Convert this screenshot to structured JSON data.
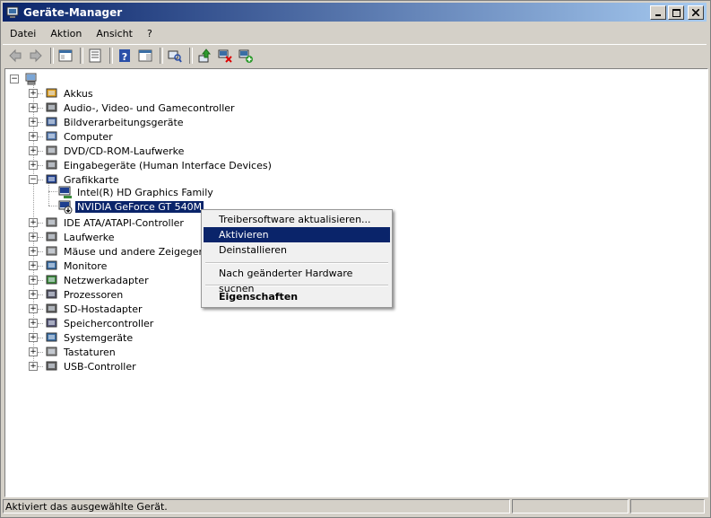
{
  "window": {
    "title": "Geräte-Manager"
  },
  "menubar": {
    "items": [
      "Datei",
      "Aktion",
      "Ansicht",
      "?"
    ]
  },
  "tree": {
    "categories": [
      {
        "label": "Akkus",
        "icon": "battery-icon"
      },
      {
        "label": "Audio-, Video- und Gamecontroller",
        "icon": "speaker-icon"
      },
      {
        "label": "Bildverarbeitungsgeräte",
        "icon": "camera-icon"
      },
      {
        "label": "Computer",
        "icon": "computer-icon"
      },
      {
        "label": "DVD/CD-ROM-Laufwerke",
        "icon": "optical-drive-icon"
      },
      {
        "label": "Eingabegeräte (Human Interface Devices)",
        "icon": "hid-icon"
      },
      {
        "label": "Grafikkarte",
        "icon": "display-adapter-icon"
      },
      {
        "label": "IDE ATA/ATAPI-Controller",
        "icon": "ide-controller-icon"
      },
      {
        "label": "Laufwerke",
        "icon": "disk-drive-icon"
      },
      {
        "label": "Mäuse und andere Zeigegeräte",
        "icon": "mouse-icon"
      },
      {
        "label": "Monitore",
        "icon": "monitor-icon"
      },
      {
        "label": "Netzwerkadapter",
        "icon": "network-adapter-icon"
      },
      {
        "label": "Prozessoren",
        "icon": "processor-icon"
      },
      {
        "label": "SD-Hostadapter",
        "icon": "sd-host-icon"
      },
      {
        "label": "Speichercontroller",
        "icon": "storage-controller-icon"
      },
      {
        "label": "Systemgeräte",
        "icon": "system-device-icon"
      },
      {
        "label": "Tastaturen",
        "icon": "keyboard-icon"
      },
      {
        "label": "USB-Controller",
        "icon": "usb-icon"
      }
    ],
    "grafikkarte_children": [
      {
        "label": "Intel(R) HD Graphics Family",
        "icon": "display-adapter-icon"
      },
      {
        "label": "NVIDIA GeForce GT 540M",
        "icon": "display-adapter-disabled-icon",
        "selected": true
      }
    ]
  },
  "context_menu": {
    "items": [
      "Treibersoftware aktualisieren...",
      "Aktivieren",
      "Deinstallieren",
      "Nach geänderter Hardware suchen",
      "Eigenschaften"
    ],
    "highlighted": "Aktivieren"
  },
  "statusbar": {
    "text": "Aktiviert das ausgewählte Gerät."
  }
}
